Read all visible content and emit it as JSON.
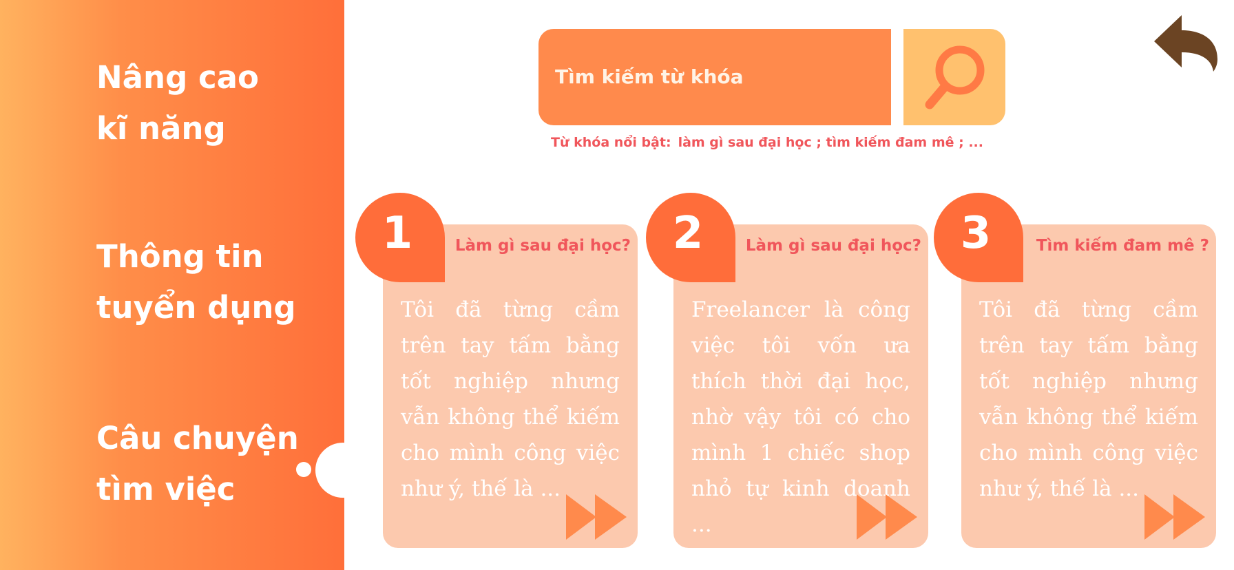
{
  "sidebar": {
    "items": [
      {
        "line1": "Nâng cao",
        "line2": "kĩ năng"
      },
      {
        "line1": "Thông tin",
        "line2": "tuyển dụng"
      },
      {
        "line1": "Câu chuyện",
        "line2": "tìm việc"
      }
    ],
    "active_index": 2
  },
  "search": {
    "placeholder": "Tìm kiếm từ khóa",
    "icon": "search-icon",
    "featured_label": "Từ khóa nổi bật:",
    "featured_keywords": "làm gì sau đại học ; tìm kiếm đam mê ; ..."
  },
  "back_icon": "back-arrow-icon",
  "cards": [
    {
      "number": "1",
      "title": "Làm gì sau đại học?",
      "text": "Tôi đã từng cầm trên tay tấm bằng tốt nghiệp nhưng vẫn không thể kiếm cho mình công việc như ý, thế là ..."
    },
    {
      "number": "2",
      "title": "Làm gì sau đại học?",
      "text": "Freelancer là công việc tôi vốn ưa thích thời đại học, nhờ vậy tôi có cho mình 1 chiếc shop nhỏ tự kinh doanh ..."
    },
    {
      "number": "3",
      "title": "Tìm kiếm đam mê ?",
      "text": "Tôi đã từng cầm trên tay tấm bằng tốt nghiệp nhưng vẫn không thể kiếm cho mình công việc như ý, thế là ..."
    }
  ],
  "colors": {
    "sidebar_start": "#FFB25F",
    "sidebar_end": "#FF6F3A",
    "search_bg": "#FF8A4C",
    "search_btn_bg": "#FFC16E",
    "card_bg": "#FCC9AE",
    "badge": "#FF6D3A",
    "accent_text": "#F0565B",
    "back_icon": "#6B4423"
  }
}
